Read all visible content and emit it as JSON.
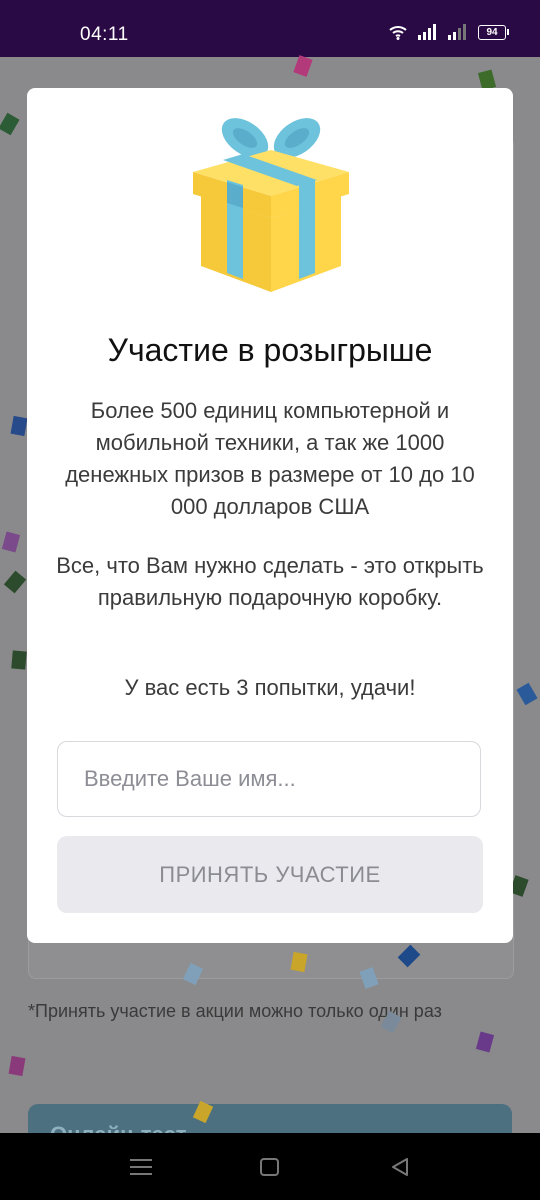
{
  "status_bar": {
    "time": "04:11",
    "battery": "94"
  },
  "background": {
    "note": "*Принять участие в акции можно только один раз",
    "button_label": "Онлайн-тест"
  },
  "modal": {
    "title": "Участие в розыгрыше",
    "paragraph1": "Более 500 единиц компьютерной и мобильной техники, а так же 1000 денежных призов в размере от 10 до 10 000 долларов США",
    "paragraph2": "Все, что Вам нужно сделать - это открыть правильную подарочную коробку.",
    "paragraph3": "У вас есть 3 попытки, удачи!",
    "name_placeholder": "Введите Ваше имя...",
    "name_value": "",
    "submit_label": "ПРИНЯТЬ УЧАСТИЕ"
  },
  "colors": {
    "status_bar": "#2a0a45",
    "gift_body": "#ffd54a",
    "gift_ribbon": "#6ec3dc",
    "button_bg": "#e9e9ee"
  }
}
